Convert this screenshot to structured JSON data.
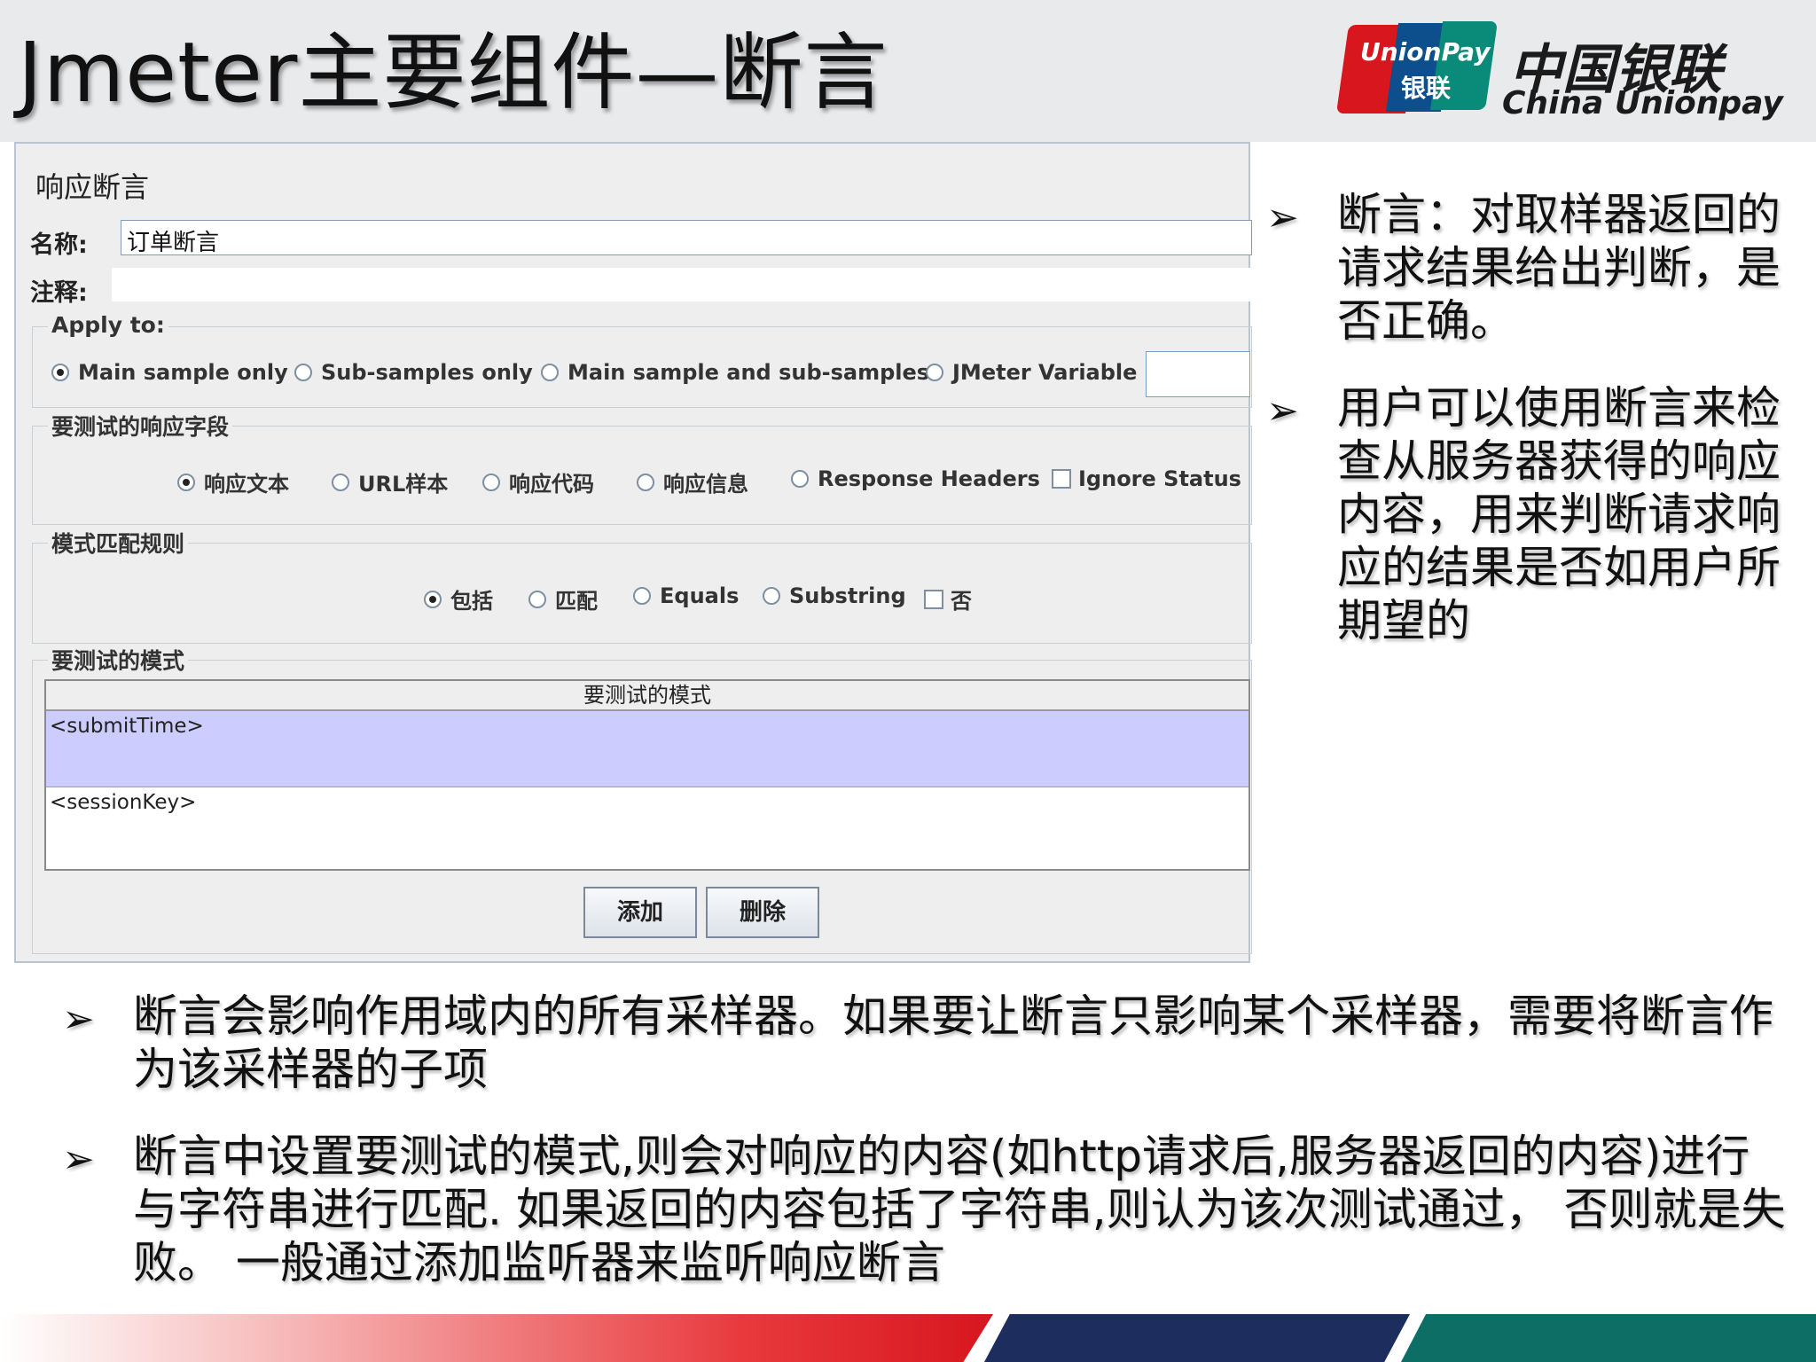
{
  "slide": {
    "title": "Jmeter主要组件—断言",
    "logo": {
      "mark_line1": "UnionPay",
      "mark_line2": "银联",
      "brand_cn": "中国银联",
      "brand_en": "China Unionpay"
    }
  },
  "panel": {
    "title": "响应断言",
    "name_label": "名称:",
    "name_value": "订单断言",
    "comment_label": "注释:",
    "comment_value": "",
    "apply_to": {
      "title": "Apply to:",
      "options": [
        "Main sample only",
        "Sub-samples only",
        "Main sample and sub-samples",
        "JMeter Variable"
      ],
      "selected": "Main sample only",
      "variable_value": ""
    },
    "response_field": {
      "title": "要测试的响应字段",
      "options": [
        "响应文本",
        "URL样本",
        "响应代码",
        "响应信息",
        "Response Headers"
      ],
      "selected": "响应文本",
      "checkbox_label": "Ignore Status",
      "checkbox_checked": false
    },
    "pattern_rules": {
      "title": "模式匹配规则",
      "options": [
        "包括",
        "匹配",
        "Equals",
        "Substring"
      ],
      "selected": "包括",
      "checkbox_label": "否",
      "checkbox_checked": false
    },
    "patterns": {
      "title": "要测试的模式",
      "column_header": "要测试的模式",
      "rows": [
        "<submitTime>",
        "<sessionKey>"
      ],
      "selected_row": 0
    },
    "buttons": {
      "add": "添加",
      "delete": "删除"
    }
  },
  "right_bullets": [
    "断言：对取样器返回的请求结果给出判断，是否正确。",
    "用户可以使用断言来检查从服务器获得的响应内容，用来判断请求响应的结果是否如用户所期望的"
  ],
  "bottom_bullets": [
    "断言会影响作用域内的所有采样器。如果要让断言只影响某个采样器，需要将断言作为该采样器的子项",
    "断言中设置要测试的模式,则会对响应的内容(如http请求后,服务器返回的内容)进行与字符串进行匹配. 如果返回的内容包括了字符串,则认为该次测试通过， 否则就是失败。 一般通过添加监听器来监听响应断言"
  ],
  "bullet_symbol": "➢",
  "colors": {
    "red": "#d7161e",
    "blue": "#1c2d5e",
    "green": "#0d6e66",
    "selected_row": "#ccccff"
  }
}
